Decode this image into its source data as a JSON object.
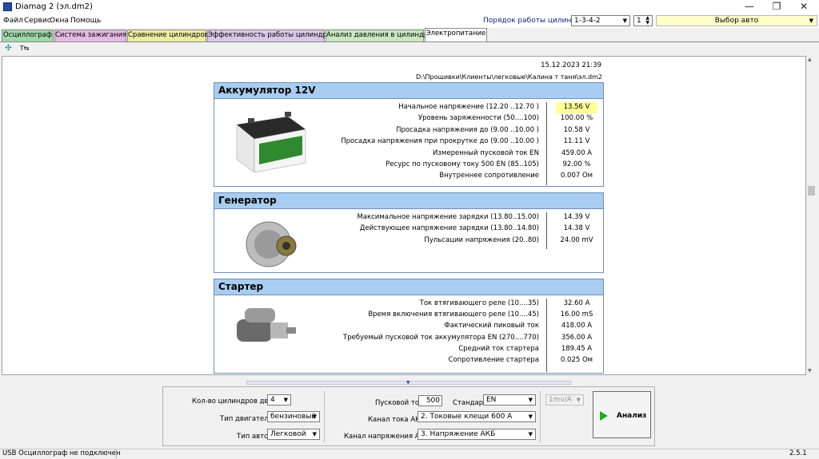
{
  "window": {
    "title": "Diamag 2 (эл.dm2)",
    "min_icon": "—",
    "max_icon": "❐",
    "close_icon": "✕"
  },
  "menu": [
    "Файл",
    "Сервис",
    "Окна",
    "Помощь"
  ],
  "header": {
    "order_label": "Порядок работы цилиндров",
    "order_value": "1-3-4-2",
    "cyl_value": "1",
    "auto_label": "Выбор авто"
  },
  "tabs": [
    "Осциллограф",
    "Система зажигания",
    "Сравнение цилиндров",
    "Эффективность работы цилиндров",
    "Анализ давления в цилиндре",
    "Электропитание"
  ],
  "report": {
    "datetime": "15.12.2023 21:39",
    "path": "D:\\Прошивки\\Клиенты\\легковые\\Калина т таня\\эл.dm2"
  },
  "battery": {
    "title": "Аккумулятор 12V",
    "rows": [
      {
        "label": "Начальное напряжение (12.20 ..12.70 )",
        "value": "13.56 V"
      },
      {
        "label": "Уровень заряженности (50....100)",
        "value": "100.00 %"
      },
      {
        "label": "Просадка напряжения до (9.00 ..10.00 )",
        "value": "10.58 V"
      },
      {
        "label": "Просадка напряжения при прокрутке до (9.00 ..10.00 )",
        "value": "11.11 V"
      },
      {
        "label": "Измеренный пусковой ток  EN",
        "value": "459.00 A"
      },
      {
        "label": "Ресурс по пусковому току  500 EN (85..105)",
        "value": "92.00 %"
      },
      {
        "label": "Внутреннее сопротивление",
        "value": "0.007 Ом"
      }
    ]
  },
  "generator": {
    "title": "Генератор",
    "rows": [
      {
        "label": "Максимальное напряжение зарядки  (13.80..15.00)",
        "value": "14.39 V"
      },
      {
        "label": "Действующее напряжение зарядки  (13.80..14.80)",
        "value": "14.38 V"
      },
      {
        "label": "Пульсации напряжения (20..80)",
        "value": "24.00 mV"
      }
    ]
  },
  "starter": {
    "title": "Стартер",
    "rows": [
      {
        "label": "Ток втягивающего реле (10....35)",
        "value": "32.60 A"
      },
      {
        "label": "Время включения втягивающего реле (10....45)",
        "value": "16.00 mS"
      },
      {
        "label": "Фактический пиковый ток",
        "value": "418.00 A"
      },
      {
        "label": "Требуемый пусковой ток аккумулятора  EN (270....770)",
        "value": "356.00 A"
      },
      {
        "label": "Средний ток стартера",
        "value": "189.45 A"
      },
      {
        "label": "Сопротивление стартера",
        "value": "0.025 Ом"
      }
    ]
  },
  "controls": {
    "cyl_count_label": "Кол-во цилиндров двиг.",
    "cyl_count": "4",
    "engine_label": "Тип двигателя",
    "engine": "бензиновый",
    "car_label": "Тип авто",
    "car": "Легковой",
    "start_current_label": "Пусковой ток",
    "start_current": "500",
    "standard_label": "Стандарт",
    "standard": "EN",
    "current_channel_label": "Канал тока АКБ",
    "current_channel": "2.  Токовые клещи 600 A",
    "voltage_channel_label": "Канал напряжения АКБ",
    "voltage_channel": "3.  Напряжение АКБ",
    "scale": "1mv/A",
    "analyze": "Анализ"
  },
  "status": {
    "left": "USB Осциллограф не подключен",
    "version": "2.5.1"
  },
  "colors": {
    "highlight": "#ffff99",
    "section_header": "#a8cdf0"
  }
}
